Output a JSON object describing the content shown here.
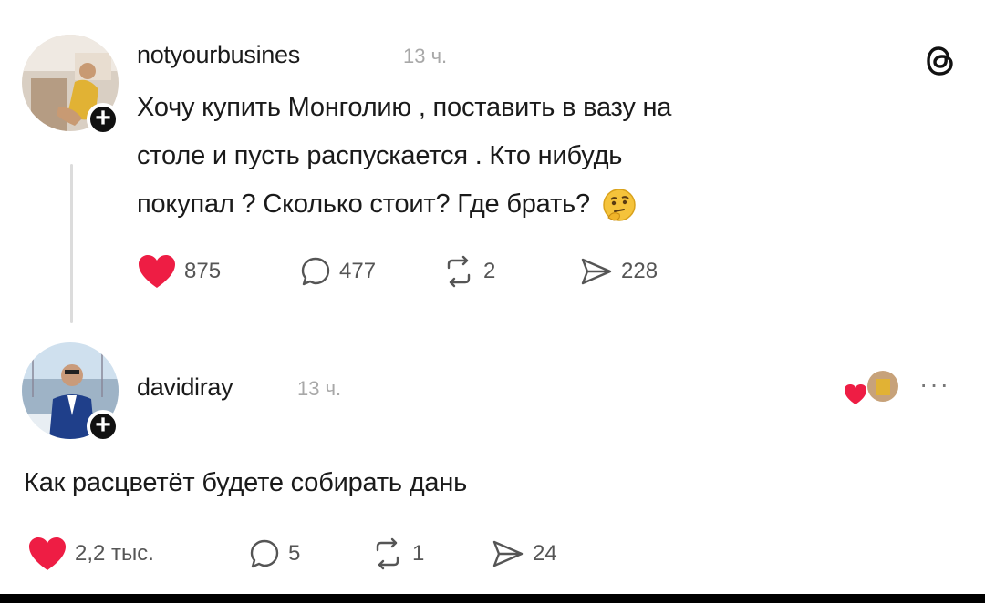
{
  "post": {
    "username": "notyourbusines",
    "time": "13 ч.",
    "text_line1": "Хочу купить Монголию , поставить в вазу на",
    "text_line2": "столе и пусть распускается . Кто нибудь",
    "text_line3": "покупал ? Сколько стоит? Где брать?",
    "emoji_icon": "thinking-face-icon",
    "likes": "875",
    "comments": "477",
    "reposts": "2",
    "shares": "228",
    "app_icon": "threads-logo-icon"
  },
  "reply": {
    "username": "davidiray",
    "time": "13 ч.",
    "text": "Как расцветёт будете собирать дань",
    "likes": "2,2 тыс.",
    "comments": "5",
    "reposts": "1",
    "shares": "24",
    "more_label": "···"
  },
  "colors": {
    "like_red": "#ee1d44",
    "text": "#1a1a1a",
    "muted": "#a8a8a8",
    "icon_gray": "#555555"
  }
}
